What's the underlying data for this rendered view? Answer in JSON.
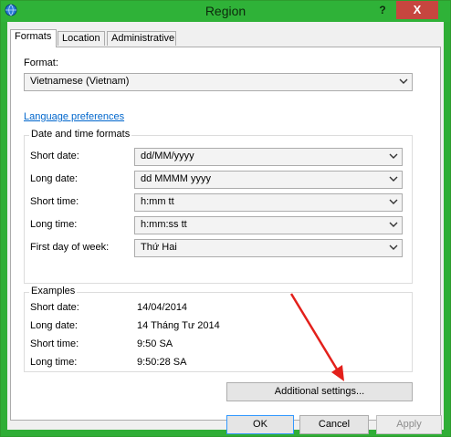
{
  "window": {
    "title": "Region",
    "help_glyph": "?",
    "close_glyph": "X"
  },
  "tabs": [
    {
      "label": "Formats",
      "active": true
    },
    {
      "label": "Location",
      "active": false
    },
    {
      "label": "Administrative",
      "active": false
    }
  ],
  "formats": {
    "format_label": "Format:",
    "format_value": "Vietnamese (Vietnam)",
    "language_link": "Language preferences"
  },
  "date_time": {
    "group_title": "Date and time formats",
    "rows": [
      {
        "label": "Short date:",
        "value": "dd/MM/yyyy"
      },
      {
        "label": "Long date:",
        "value": "dd MMMM yyyy"
      },
      {
        "label": "Short time:",
        "value": "h:mm tt"
      },
      {
        "label": "Long time:",
        "value": "h:mm:ss tt"
      },
      {
        "label": "First day of week:",
        "value": "Thứ Hai"
      }
    ]
  },
  "examples": {
    "group_title": "Examples",
    "rows": [
      {
        "label": "Short date:",
        "value": "14/04/2014"
      },
      {
        "label": "Long date:",
        "value": "14 Tháng Tư 2014"
      },
      {
        "label": "Short time:",
        "value": "9:50 SA"
      },
      {
        "label": "Long time:",
        "value": "9:50:28 SA"
      }
    ]
  },
  "buttons": {
    "additional_settings": "Additional settings...",
    "ok": "OK",
    "cancel": "Cancel",
    "apply": "Apply"
  },
  "colors": {
    "title_bar": "#2fb238",
    "close_button": "#c7463f",
    "link": "#0066cc",
    "annotation_arrow": "#e3201b"
  },
  "icons": {
    "app": "globe-clock-icon",
    "dropdown": "chevron-down-icon"
  }
}
